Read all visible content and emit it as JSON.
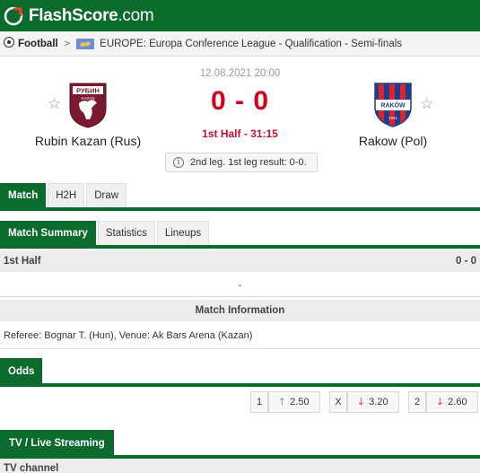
{
  "brand": {
    "name_main": "FlashScore",
    "name_tld": ".com",
    "green": "#0a6b2d",
    "score_red": "#d5001c"
  },
  "breadcrumb": {
    "sport": "Football",
    "competition": "EUROPE: Europa Conference League - Qualification - Semi-finals",
    "separator": ">"
  },
  "match": {
    "date": "12.08.2021 20:00",
    "score": "0 - 0",
    "status": "1st Half - 31:15",
    "info": "2nd leg. 1st leg result: 0-0.",
    "home": {
      "name": "Rubin Kazan (Rus)",
      "logo_text": "РУБИН",
      "logo_sub": "KAZAN"
    },
    "away": {
      "name": "Rakow (Pol)",
      "logo_text": "RAKÓW",
      "logo_sub": "1921"
    }
  },
  "main_tabs": [
    "Match",
    "H2H",
    "Draw"
  ],
  "sub_tabs": [
    "Match Summary",
    "Statistics",
    "Lineups"
  ],
  "summary": {
    "period_label": "1st Half",
    "period_score": "0 - 0",
    "no_events": "-"
  },
  "match_information": {
    "title": "Match Information",
    "details": "Referee: Bognar T. (Hun), Venue: Ak Bars Arena (Kazan)"
  },
  "odds": {
    "tab_label": "Odds",
    "items": [
      {
        "label": "1",
        "value": "2.50",
        "trend": "up"
      },
      {
        "label": "X",
        "value": "3.20",
        "trend": "down"
      },
      {
        "label": "2",
        "value": "2.60",
        "trend": "down"
      }
    ]
  },
  "tv": {
    "tab_label": "TV / Live Streaming",
    "channel_label": "TV channel"
  }
}
